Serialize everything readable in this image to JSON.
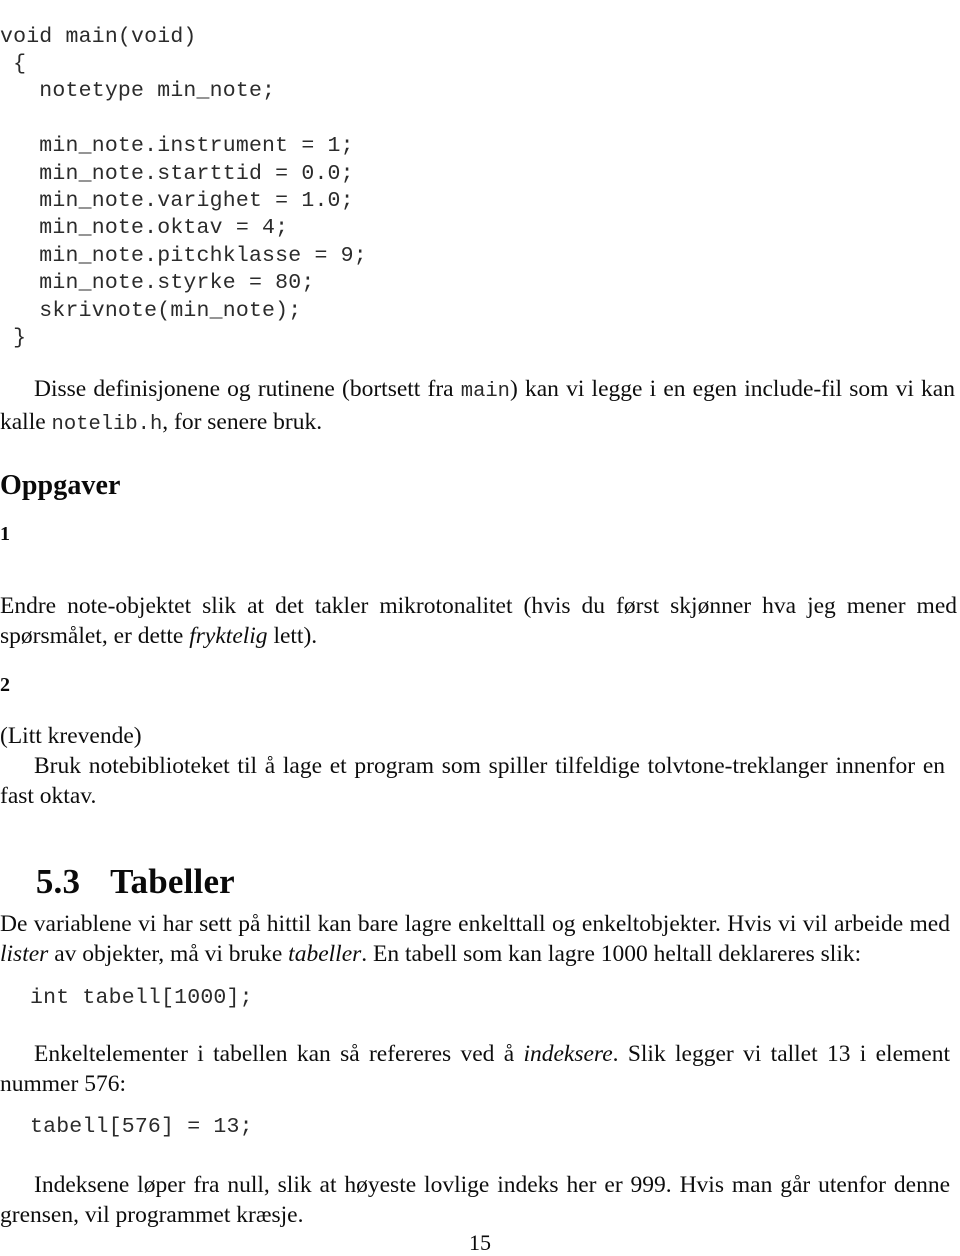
{
  "document": {
    "page_number": "15",
    "language": "Norwegian"
  },
  "code_main": {
    "lines": [
      "void main(void)",
      " {",
      "   notetype min_note;",
      "",
      "   min_note.instrument = 1;",
      "   min_note.starttid = 0.0;",
      "   min_note.varighet = 1.0;",
      "   min_note.oktav = 4;",
      "   min_note.pitchklasse = 9;",
      "   min_note.styrke = 80;",
      "   skrivnote(min_note);",
      " }"
    ],
    "full_text": "void main(void)\n {\n   notetype min_note;\n\n   min_note.instrument = 1;\n   min_note.starttid = 0.0;\n   min_note.varighet = 1.0;\n   min_note.oktav = 4;\n   min_note.pitchklasse = 9;\n   min_note.styrke = 80;\n   skrivnote(min_note);\n }"
  },
  "para_include": {
    "part1": "Disse definisjonene og rutinene (bortsett fra ",
    "code1": "main",
    "part2": ") kan vi legge i en egen include-fil som vi kan kalle ",
    "code2": "notelib.h",
    "part3": ", for senere bruk."
  },
  "exercises": {
    "heading": "Oppgaver",
    "items": [
      {
        "number": "1",
        "text_part1": "Endre note-objektet slik at det takler mikrotonalitet (hvis du først skjønner hva jeg mener med spørsmålet, er dette ",
        "italic": "fryktelig",
        "text_part2": " lett)."
      },
      {
        "number": "2",
        "lead": "(Litt krevende)",
        "text_part1": "Bruk notebiblioteket til å lage et program som spiller tilfeldige tolvtone-treklanger innenfor en fast oktav.",
        "italic": "",
        "text_part2": ""
      }
    ]
  },
  "section": {
    "number": "5.3",
    "title": "Tabeller"
  },
  "para_tabeller": {
    "part1": "De variablene vi har sett på hittil kan bare lagre enkelttall og enkeltobjekter. Hvis vi vil arbeide med ",
    "italic1": "lister",
    "part2": " av objekter, må vi bruke ",
    "italic2": "tabeller",
    "part3": ". En tabell som kan lagre 1000 heltall deklareres slik:"
  },
  "code_decl": {
    "text": "int tabell[1000];"
  },
  "para_indeksere": {
    "part1": "Enkeltelementer i tabellen kan så refereres ved å ",
    "italic1": "indeksere",
    "part2": ". Slik legger vi tallet 13 i element nummer 576:"
  },
  "code_assign": {
    "text": "tabell[576] = 13;"
  },
  "para_indekser": {
    "part1": "Indeksene løper fra null, slik at høyeste lovlige indeks her er 999. Hvis man går utenfor denne grensen, vil programmet kræsje.",
    "italic1": "",
    "part2": ""
  }
}
